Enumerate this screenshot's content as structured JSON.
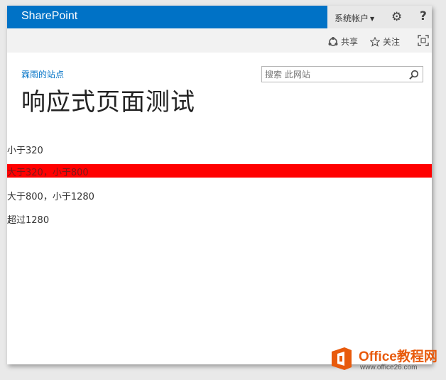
{
  "suite": {
    "brand": "SharePoint",
    "account": "系统帐户",
    "gear_icon": "gear-icon",
    "help": "?"
  },
  "ribbon": {
    "share_label": "共享",
    "follow_label": "关注"
  },
  "site": {
    "site_name": "霖雨的站点",
    "page_title": "响应式页面测试"
  },
  "search": {
    "placeholder": "搜索 此网站"
  },
  "content": {
    "line1": "小于320",
    "line2": "大于320，小于800",
    "line3": "大于800，小于1280",
    "line4": "超过1280"
  },
  "colors": {
    "suite_bar": "#0072c6",
    "highlight": "#ff0000",
    "logo_orange": "#e85a0c"
  },
  "watermark": {
    "brand": "Office教程网",
    "url": "www.office26.com"
  }
}
